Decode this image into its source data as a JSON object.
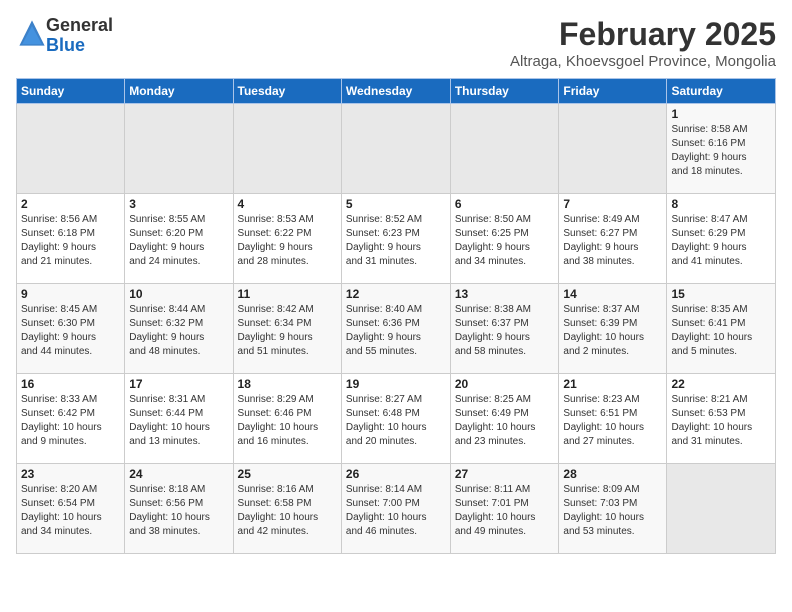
{
  "header": {
    "logo_line1": "General",
    "logo_line2": "Blue",
    "month_title": "February 2025",
    "subtitle": "Altraga, Khoevsgoel Province, Mongolia"
  },
  "weekdays": [
    "Sunday",
    "Monday",
    "Tuesday",
    "Wednesday",
    "Thursday",
    "Friday",
    "Saturday"
  ],
  "weeks": [
    [
      {
        "day": "",
        "info": ""
      },
      {
        "day": "",
        "info": ""
      },
      {
        "day": "",
        "info": ""
      },
      {
        "day": "",
        "info": ""
      },
      {
        "day": "",
        "info": ""
      },
      {
        "day": "",
        "info": ""
      },
      {
        "day": "1",
        "info": "Sunrise: 8:58 AM\nSunset: 6:16 PM\nDaylight: 9 hours\nand 18 minutes."
      }
    ],
    [
      {
        "day": "2",
        "info": "Sunrise: 8:56 AM\nSunset: 6:18 PM\nDaylight: 9 hours\nand 21 minutes."
      },
      {
        "day": "3",
        "info": "Sunrise: 8:55 AM\nSunset: 6:20 PM\nDaylight: 9 hours\nand 24 minutes."
      },
      {
        "day": "4",
        "info": "Sunrise: 8:53 AM\nSunset: 6:22 PM\nDaylight: 9 hours\nand 28 minutes."
      },
      {
        "day": "5",
        "info": "Sunrise: 8:52 AM\nSunset: 6:23 PM\nDaylight: 9 hours\nand 31 minutes."
      },
      {
        "day": "6",
        "info": "Sunrise: 8:50 AM\nSunset: 6:25 PM\nDaylight: 9 hours\nand 34 minutes."
      },
      {
        "day": "7",
        "info": "Sunrise: 8:49 AM\nSunset: 6:27 PM\nDaylight: 9 hours\nand 38 minutes."
      },
      {
        "day": "8",
        "info": "Sunrise: 8:47 AM\nSunset: 6:29 PM\nDaylight: 9 hours\nand 41 minutes."
      }
    ],
    [
      {
        "day": "9",
        "info": "Sunrise: 8:45 AM\nSunset: 6:30 PM\nDaylight: 9 hours\nand 44 minutes."
      },
      {
        "day": "10",
        "info": "Sunrise: 8:44 AM\nSunset: 6:32 PM\nDaylight: 9 hours\nand 48 minutes."
      },
      {
        "day": "11",
        "info": "Sunrise: 8:42 AM\nSunset: 6:34 PM\nDaylight: 9 hours\nand 51 minutes."
      },
      {
        "day": "12",
        "info": "Sunrise: 8:40 AM\nSunset: 6:36 PM\nDaylight: 9 hours\nand 55 minutes."
      },
      {
        "day": "13",
        "info": "Sunrise: 8:38 AM\nSunset: 6:37 PM\nDaylight: 9 hours\nand 58 minutes."
      },
      {
        "day": "14",
        "info": "Sunrise: 8:37 AM\nSunset: 6:39 PM\nDaylight: 10 hours\nand 2 minutes."
      },
      {
        "day": "15",
        "info": "Sunrise: 8:35 AM\nSunset: 6:41 PM\nDaylight: 10 hours\nand 5 minutes."
      }
    ],
    [
      {
        "day": "16",
        "info": "Sunrise: 8:33 AM\nSunset: 6:42 PM\nDaylight: 10 hours\nand 9 minutes."
      },
      {
        "day": "17",
        "info": "Sunrise: 8:31 AM\nSunset: 6:44 PM\nDaylight: 10 hours\nand 13 minutes."
      },
      {
        "day": "18",
        "info": "Sunrise: 8:29 AM\nSunset: 6:46 PM\nDaylight: 10 hours\nand 16 minutes."
      },
      {
        "day": "19",
        "info": "Sunrise: 8:27 AM\nSunset: 6:48 PM\nDaylight: 10 hours\nand 20 minutes."
      },
      {
        "day": "20",
        "info": "Sunrise: 8:25 AM\nSunset: 6:49 PM\nDaylight: 10 hours\nand 23 minutes."
      },
      {
        "day": "21",
        "info": "Sunrise: 8:23 AM\nSunset: 6:51 PM\nDaylight: 10 hours\nand 27 minutes."
      },
      {
        "day": "22",
        "info": "Sunrise: 8:21 AM\nSunset: 6:53 PM\nDaylight: 10 hours\nand 31 minutes."
      }
    ],
    [
      {
        "day": "23",
        "info": "Sunrise: 8:20 AM\nSunset: 6:54 PM\nDaylight: 10 hours\nand 34 minutes."
      },
      {
        "day": "24",
        "info": "Sunrise: 8:18 AM\nSunset: 6:56 PM\nDaylight: 10 hours\nand 38 minutes."
      },
      {
        "day": "25",
        "info": "Sunrise: 8:16 AM\nSunset: 6:58 PM\nDaylight: 10 hours\nand 42 minutes."
      },
      {
        "day": "26",
        "info": "Sunrise: 8:14 AM\nSunset: 7:00 PM\nDaylight: 10 hours\nand 46 minutes."
      },
      {
        "day": "27",
        "info": "Sunrise: 8:11 AM\nSunset: 7:01 PM\nDaylight: 10 hours\nand 49 minutes."
      },
      {
        "day": "28",
        "info": "Sunrise: 8:09 AM\nSunset: 7:03 PM\nDaylight: 10 hours\nand 53 minutes."
      },
      {
        "day": "",
        "info": ""
      }
    ]
  ]
}
